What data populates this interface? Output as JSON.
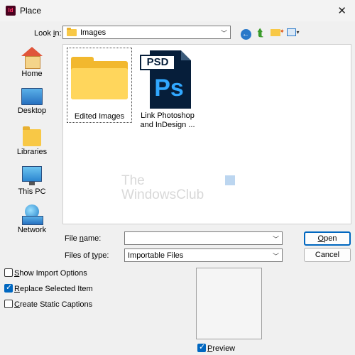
{
  "window": {
    "title": "Place",
    "app_icon_text": "Id",
    "close_glyph": "✕"
  },
  "lookin": {
    "label_prefix": "Look ",
    "label_underlined": "i",
    "label_suffix": "n:",
    "value": "Images"
  },
  "toolbar": {
    "back": "back-icon",
    "up": "up-folder-icon",
    "new_folder": "new-folder-icon",
    "views": "views-menu-icon"
  },
  "places": [
    {
      "label": "Home",
      "icon": "home-icon"
    },
    {
      "label": "Desktop",
      "icon": "desktop-icon"
    },
    {
      "label": "Libraries",
      "icon": "libraries-icon"
    },
    {
      "label": "This PC",
      "icon": "this-pc-icon"
    },
    {
      "label": "Network",
      "icon": "network-icon"
    }
  ],
  "files": [
    {
      "name": "Edited Images",
      "type": "folder",
      "selected": true
    },
    {
      "name_line1": "Link Photoshop",
      "name_line2": "and InDesign ...",
      "type": "psd",
      "tag": "PSD",
      "glyph": "Ps"
    }
  ],
  "watermark": {
    "line1": "The",
    "line2": "WindowsClub"
  },
  "filename": {
    "label_prefix": "File ",
    "label_underlined": "n",
    "label_suffix": "ame:",
    "value": ""
  },
  "filetype": {
    "label_prefix": "Files of ",
    "label_underlined": "t",
    "label_suffix": "ype:",
    "value": "Importable Files"
  },
  "buttons": {
    "open_underlined": "O",
    "open_rest": "pen",
    "cancel": "Cancel"
  },
  "options": [
    {
      "underlined": "S",
      "rest": "how Import Options",
      "checked": false
    },
    {
      "underlined": "R",
      "rest": "eplace Selected Item",
      "checked": true
    },
    {
      "underlined": "C",
      "rest": "reate Static Captions",
      "checked": false
    }
  ],
  "preview": {
    "underlined": "P",
    "rest": "review",
    "checked": true
  },
  "colors": {
    "accent": "#0067c0",
    "folder": "#ffd65c",
    "psd_bg": "#061e3a",
    "ps_text": "#31a8ff"
  }
}
